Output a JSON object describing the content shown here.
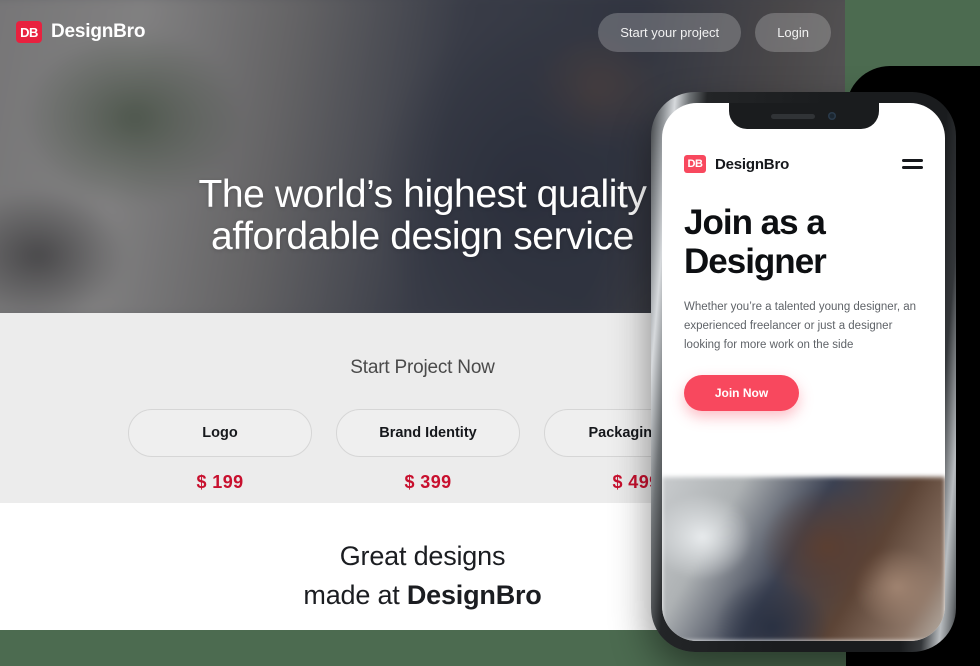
{
  "desktop": {
    "logo": {
      "mark": "DB",
      "word": "DesignBro",
      "mark_color": "#e8213f"
    },
    "nav": {
      "start_project_label": "Start your project",
      "login_label": "Login"
    },
    "hero": {
      "headline": "The world’s highest quality affordable design service"
    },
    "pricing": {
      "title": "Start Project Now",
      "cards": [
        {
          "label": "Logo",
          "price": "$ 199"
        },
        {
          "label": "Brand Identity",
          "price": "$ 399"
        },
        {
          "label": "Packaging De",
          "price": "$ 499"
        }
      ],
      "accent_color": "#c8102e",
      "band_color": "#ececec"
    },
    "closing": {
      "line1": "Great designs",
      "line2_prefix": "made at ",
      "line2_brand": "DesignBro"
    }
  },
  "phone": {
    "logo": {
      "mark": "DB",
      "word": "DesignBro",
      "mark_color": "#f8485e"
    },
    "menu_icon": "hamburger-icon",
    "hero": {
      "title": "Join as a Designer",
      "subtitle": "Whether you’re a talented young designer, an experienced freelancer or just a designer looking for more work on the side",
      "cta_label": "Join Now",
      "cta_color": "#f8485e"
    }
  },
  "page": {
    "backdrop_color": "#4c6b50",
    "shadow_color": "#000000"
  }
}
